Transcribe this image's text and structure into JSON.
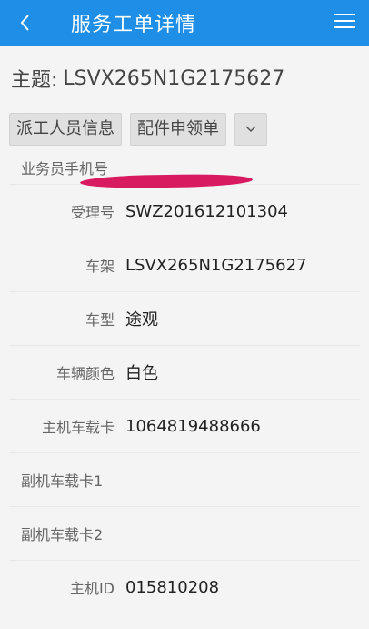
{
  "header": {
    "title": "服务工单详情"
  },
  "subject": {
    "label": "主题:",
    "value": "LSVX265N1G2175627"
  },
  "tabs": [
    {
      "label": "派工人员信息"
    },
    {
      "label": "配件申领单"
    }
  ],
  "rows": [
    {
      "label": "业务员手机号",
      "value": ""
    },
    {
      "label": "受理号",
      "value": "SWZ201612101304"
    },
    {
      "label": "车架",
      "value": "LSVX265N1G2175627"
    },
    {
      "label": "车型",
      "value": "途观"
    },
    {
      "label": "车辆颜色",
      "value": "白色"
    },
    {
      "label": "主机车载卡",
      "value": "1064819488666"
    },
    {
      "label": "副机车载卡1",
      "value": ""
    },
    {
      "label": "副机车载卡2",
      "value": ""
    },
    {
      "label": "主机ID",
      "value": "015810208"
    }
  ],
  "colors": {
    "header_bg": "#1e8ee6",
    "redaction": "#d81b60"
  },
  "icons": [
    "back-arrow-icon",
    "hamburger-menu-icon",
    "chevron-down-icon"
  ]
}
